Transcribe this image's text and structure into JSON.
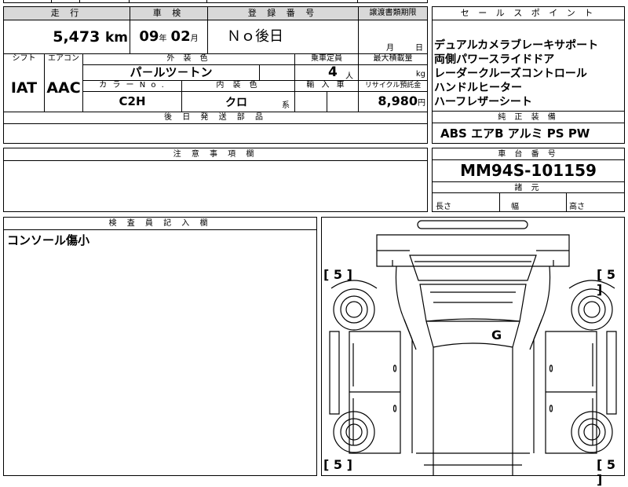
{
  "headers": {
    "mileage": "走 行",
    "inspection": "車 検",
    "registration": "登 録 番 号",
    "transfer_deadline": "譲渡書類期限",
    "shift": "シフト",
    "aircon": "エアコン",
    "exterior_color": "外 装 色",
    "capacity": "乗車定員",
    "max_load": "最大積載量",
    "color_no": "カ ラ ー N o .",
    "interior_color": "内 装 色",
    "import": "輸 入 車",
    "recycle_fee": "リサイクル預託金",
    "later_parts": "後 日 発 送 部 品",
    "sales_points": "セ ー ル ス ポ イ ン ト",
    "factory_equipment": "純 正 装 備",
    "notes": "注 意 事 項 欄",
    "chassis_number": "車 台 番 号",
    "dimensions": "諸 元",
    "inspector_notes": "検 査 員 記 入 欄"
  },
  "vehicle": {
    "mileage": "5,473",
    "mileage_unit": "km",
    "inspection_year": "09",
    "inspection_year_unit": "年",
    "inspection_month": "02",
    "inspection_month_unit": "月",
    "registration": "Ｎｏ後日",
    "transfer_month_unit": "月",
    "transfer_day_unit": "日",
    "shift": "IAT",
    "aircon": "AAC",
    "exterior_color": "パ－ルツ－トン",
    "capacity": "4",
    "capacity_unit": "人",
    "max_load_unit": "kg",
    "color_no": "C2H",
    "interior_color": "クロ",
    "interior_color_suffix": "系",
    "recycle_fee": "8,980",
    "recycle_fee_unit": "円",
    "chassis_number": "MM94S-101159"
  },
  "sales_points": [
    "デュアルカメラブレーキサポート",
    "両側パワースライドドア",
    "レーダークルーズコントロール",
    "ハンドルヒーター",
    "ハーフレザーシート"
  ],
  "factory_equipment": "ABS エアB アルミ PS PW",
  "dimensions": {
    "length": "長さ",
    "width": "幅",
    "height": "高さ"
  },
  "inspector_note": "コンソール傷小",
  "diagram": {
    "tyre_fl": "[ 5 ]",
    "tyre_fr": "[ 5 ]",
    "tyre_rl": "[ 5 ]",
    "tyre_rr": "[ 5 ]",
    "roof_mark": "G"
  }
}
